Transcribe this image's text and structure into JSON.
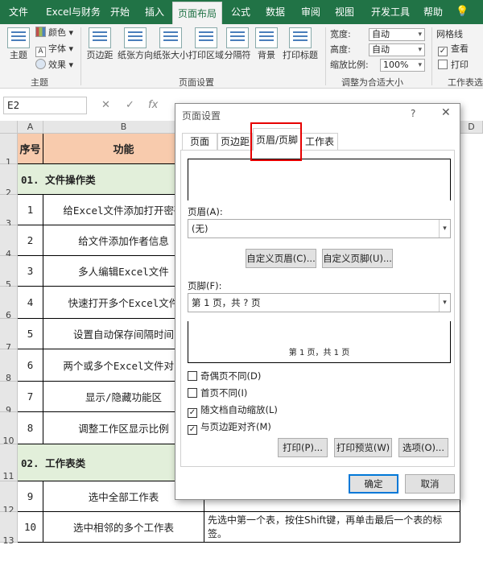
{
  "tabs": [
    "文件",
    "Excel与财务",
    "开始",
    "插入",
    "页面布局",
    "公式",
    "数据",
    "审阅",
    "视图",
    "开发工具",
    "帮助"
  ],
  "ribbon": {
    "theme_label": "主题",
    "colors_label": "颜色",
    "fonts_label": "字体",
    "effects_label": "效果",
    "theme_group": "主题",
    "margins": "页边距",
    "orientation": "纸张方向",
    "size": "纸张大小",
    "print_area": "打印区域",
    "breaks": "分隔符",
    "background": "背景",
    "print_titles": "打印标题",
    "page_setup_group": "页面设置",
    "width_label": "宽度:",
    "width_val": "自动",
    "height_label": "高度:",
    "height_val": "自动",
    "scale_label": "缩放比例:",
    "scale_val": "100%",
    "scale_group": "调整为合适大小",
    "gridlines": "网格线",
    "view": "查看",
    "print": "打印",
    "sheet_group": "工作表选项"
  },
  "formula_bar": {
    "name_box": "E2",
    "cancel": "✕",
    "enter": "✓",
    "fx": "fx"
  },
  "columns": [
    "A",
    "B",
    "D"
  ],
  "header_row": {
    "num": "序号",
    "func": "功能"
  },
  "rows": [
    {
      "rn": "1"
    },
    {
      "rn": "2",
      "section": "01. 文件操作类"
    },
    {
      "rn": "3",
      "num": "1",
      "func": "给Excel文件添加打开密码"
    },
    {
      "rn": "4",
      "num": "2",
      "func": "给文件添加作者信息"
    },
    {
      "rn": "5",
      "num": "3",
      "func": "多人编辑Excel文件"
    },
    {
      "rn": "6",
      "num": "4",
      "func": "快速打开多个Excel文件"
    },
    {
      "rn": "7",
      "num": "5",
      "func": "设置自动保存间隔时间"
    },
    {
      "rn": "8",
      "num": "6",
      "func": "两个或多个Excel文件对比"
    },
    {
      "rn": "9",
      "num": "7",
      "func": "显示/隐藏功能区"
    },
    {
      "rn": "10",
      "num": "8",
      "func": "调整工作区显示比例"
    },
    {
      "rn": "11",
      "section": "02. 工作表类"
    },
    {
      "rn": "12",
      "num": "9",
      "func": "选中全部工作表"
    },
    {
      "rn": "13",
      "num": "10",
      "func": "选中相邻的多个工作表",
      "desc": "先选中第一个表，按住Shift键，再单击最后一个表的标签。"
    }
  ],
  "dialog": {
    "title": "页面设置",
    "help": "?",
    "close": "✕",
    "tabs": [
      "页面",
      "页边距",
      "页眉/页脚",
      "工作表"
    ],
    "header_label": "页眉(A):",
    "header_value": "(无)",
    "custom_header": "自定义页眉(C)...",
    "custom_footer": "自定义页脚(U)...",
    "footer_label": "页脚(F):",
    "footer_value": "第 1 页，共 ? 页",
    "footer_preview": "第 1 页，共 1 页",
    "checks": [
      {
        "label": "奇偶页不同(D)",
        "checked": false
      },
      {
        "label": "首页不同(I)",
        "checked": false
      },
      {
        "label": "随文档自动缩放(L)",
        "checked": true
      },
      {
        "label": "与页边距对齐(M)",
        "checked": true
      }
    ],
    "print_btn": "打印(P)...",
    "preview_btn": "打印预览(W)",
    "options_btn": "选项(O)...",
    "ok": "确定",
    "cancel": "取消"
  }
}
